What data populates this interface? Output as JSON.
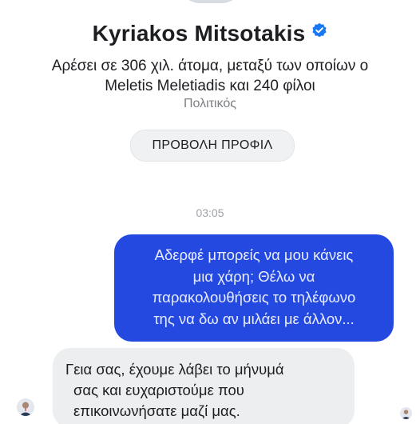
{
  "profile": {
    "name": "Kyriakos Mitsotakis",
    "verified_icon": "verified-badge-icon",
    "likes_line_1": "Αρέσει σε 306 χιλ. άτομα, μεταξύ των οποίων ο",
    "likes_line_2": "Meletis Meletiadis και 240 φίλοι",
    "category": "Πολιτικός",
    "view_profile_label": "ΠΡΟΒΟΛΗ ΠΡΟΦΙΛ"
  },
  "conversation": {
    "timestamp": "03:05",
    "outgoing_message": {
      "lines": [
        "Αδερφέ μπορείς να μου κάνεις",
        "μια χάρη; Θέλω να",
        "παρακολουθήσεις το τηλέφωνο",
        "της να δω αν μιλάει με άλλον..."
      ]
    },
    "incoming_message": {
      "lines": [
        "Γεια σας, έχουμε λάβει το μήνυμά",
        "σας και ευχαριστούμε που",
        "επικοινωνήσατε μαζί μας."
      ]
    }
  },
  "colors": {
    "outgoing_bubble": "#2449e0",
    "outgoing_text": "#e9edff",
    "incoming_bubble": "#edeef0",
    "verified_badge": "#1877f2",
    "secondary_text": "#7b7e83"
  }
}
